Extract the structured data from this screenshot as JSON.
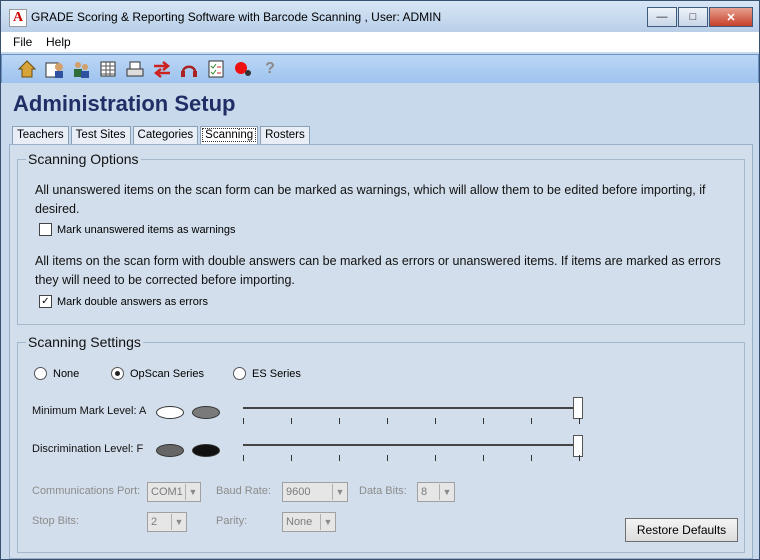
{
  "window": {
    "app_icon": "A",
    "title": "GRADE Scoring & Reporting Software with Barcode Scanning , User: ADMIN",
    "buttons": {
      "minimize": "—",
      "maximize": "□",
      "close": "✕"
    }
  },
  "menu": [
    "File",
    "Help"
  ],
  "toolbar": [
    "home-icon",
    "new-teacher-icon",
    "people-icon",
    "grid-icon",
    "printer-icon",
    "transfer-icon",
    "headset-icon",
    "checklist-icon",
    "record-icon",
    "help-icon"
  ],
  "page_title": "Administration Setup",
  "tabs": [
    "Teachers",
    "Test Sites",
    "Categories",
    "Scanning",
    "Rosters"
  ],
  "active_tab": "Scanning",
  "scanning_options": {
    "legend": "Scanning Options",
    "unanswered_text": "All unanswered items on the scan form can be marked as warnings, which will allow them to be edited before importing, if desired.",
    "unanswered_checkbox": "Mark unanswered items as warnings",
    "unanswered_checked": false,
    "double_text": "All items on the scan form with double answers can be marked as errors or unanswered items. If items are marked as errors they will need to be corrected before importing.",
    "double_checkbox": "Mark double answers as errors",
    "double_checked": true
  },
  "scanning_settings": {
    "legend": "Scanning Settings",
    "radios": [
      "None",
      "OpScan Series",
      "ES Series"
    ],
    "selected_radio": "OpScan Series",
    "min_mark_label": "Minimum Mark Level: A",
    "discrimination_label": "Discrimination Level: F",
    "min_mark_level": 1.0,
    "discrimination_level": 1.0,
    "communications_port_label": "Communications Port:",
    "communications_port": "COM1",
    "baud_rate_label": "Baud Rate:",
    "baud_rate": "9600",
    "data_bits_label": "Data Bits:",
    "data_bits": "8",
    "stop_bits_label": "Stop Bits:",
    "stop_bits": "2",
    "parity_label": "Parity:",
    "parity": "None",
    "restore_button": "Restore Defaults"
  },
  "colors": {
    "title": "#1f2f66",
    "toolbar": "#9ec3ee",
    "background": "#c9d9ec"
  }
}
